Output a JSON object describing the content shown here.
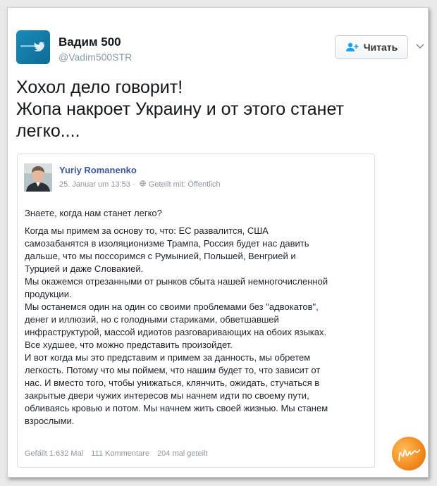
{
  "tweet": {
    "author_name": "Вадим 500",
    "author_handle": "@Vadim500STR",
    "follow_label": "Читать",
    "text_lines": [
      "Хохол дело говорит!",
      "Жопа накроет Украину и от этого станет",
      "легко...."
    ]
  },
  "embedded_post": {
    "author_name": "Yuriy Romanenko",
    "date": "25. Januar um 13:53",
    "separator": "·",
    "visibility": "Geteilt mit: Öffentlich",
    "question": "Знаете, когда нам станет легко?",
    "body_lines": [
      "Когда мы примем за основу то, что: ЕС развалится, США",
      "самозабанятся в изоляционизме Трампа, Россия будет нас давить",
      "дальше, что мы поссоримся с Румынией, Польшей, Венгрией и",
      "Турцией и даже Словакией.",
      "Мы окажемся отрезанными от рынков сбыта нашей немногочисленной",
      "продукции.",
      "Мы останемся один на один со своими проблемами без \"адвокатов\",",
      "денег и иллюзий, но с голодными стариками, обветшавшей",
      "инфраструктурой, массой идиотов разговаривающих на обоих языках.",
      "Все худшее, что можно представить произойдет.",
      "И вот когда мы это представим и примем за данность, мы обретем",
      "легкость. Потому что мы поймем, что нашим будет то, что зависит от",
      "нас. И вместо того, чтобы унижаться, клянчить, ожидать, стучаться в",
      "закрытые двери чужих интересов мы начнем идти по своему пути,",
      "обливаясь кровью и потом. Мы начнем жить своей жизнью. Мы станем",
      "взрослыми."
    ],
    "likes": "Gefällt 1.632 Mal",
    "comments": "111 Kommentare",
    "shares": "204 mal geteilt"
  },
  "colors": {
    "fb_name": "#3b5998",
    "handle": "#8899a6",
    "watermark": "#f08a1c"
  }
}
